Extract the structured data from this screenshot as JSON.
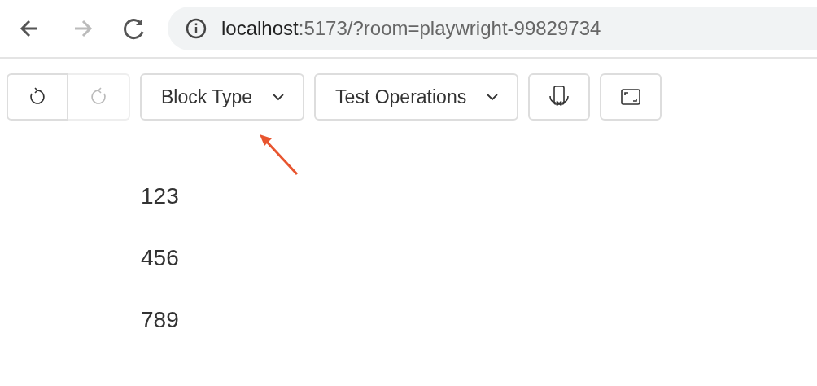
{
  "browser": {
    "back": {
      "disabled": false
    },
    "forward": {
      "disabled": true
    },
    "url_host": "localhost",
    "url_rest": ":5173/?room=playwright-99829734"
  },
  "toolbar": {
    "undo": {
      "disabled": false
    },
    "redo": {
      "disabled": true
    },
    "dropdowns": [
      {
        "label": "Block Type"
      },
      {
        "label": "Test Operations"
      }
    ]
  },
  "paragraphs": [
    "123",
    "456",
    "789"
  ]
}
